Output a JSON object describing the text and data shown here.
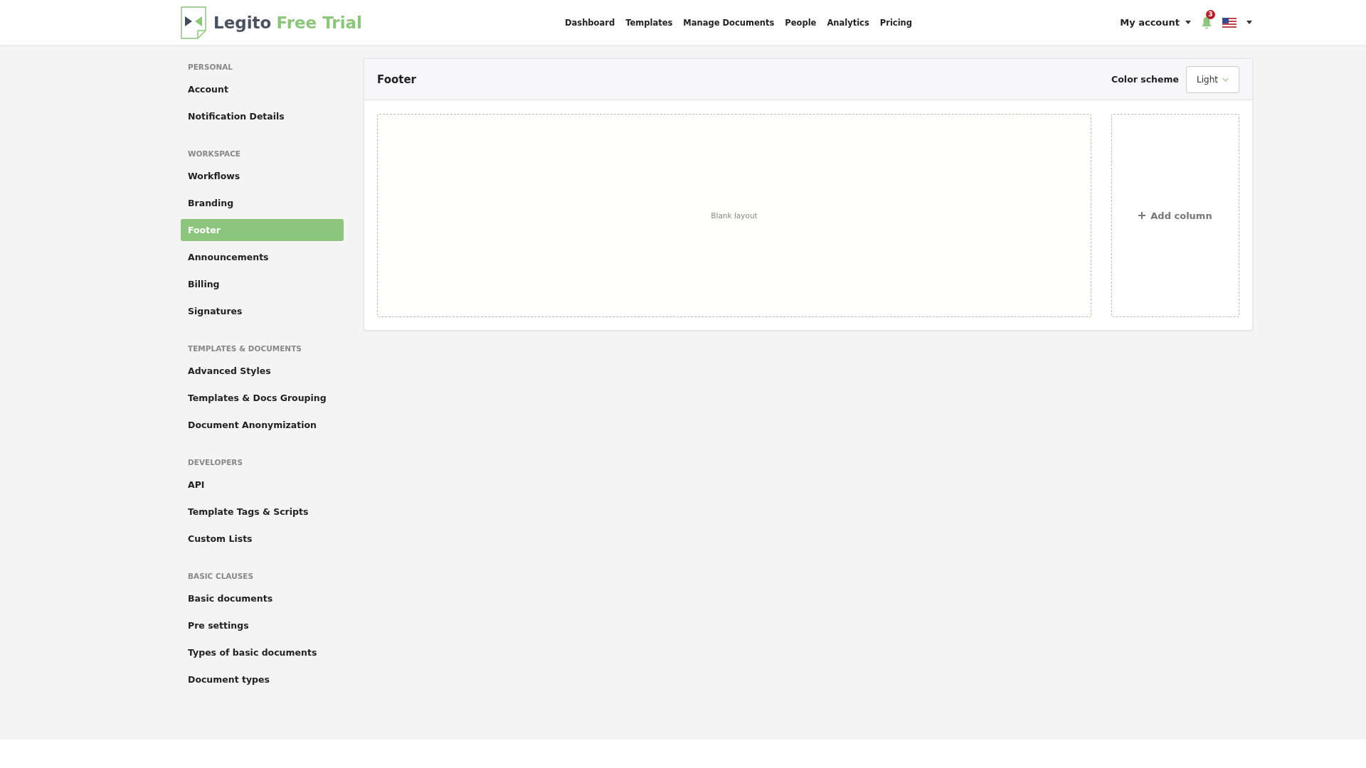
{
  "brand": {
    "name": "Legito",
    "suffix": "Free Trial"
  },
  "nav": [
    {
      "label": "Dashboard"
    },
    {
      "label": "Templates"
    },
    {
      "label": "Manage Documents"
    },
    {
      "label": "People"
    },
    {
      "label": "Analytics"
    },
    {
      "label": "Pricing"
    }
  ],
  "account": {
    "label": "My account",
    "notifications": "3"
  },
  "sidebar": [
    {
      "heading": "PERSONAL",
      "items": [
        {
          "label": "Account",
          "selected": false
        },
        {
          "label": "Notification Details",
          "selected": false
        }
      ]
    },
    {
      "heading": "WORKSPACE",
      "items": [
        {
          "label": "Workflows",
          "selected": false
        },
        {
          "label": "Branding",
          "selected": false
        },
        {
          "label": "Footer",
          "selected": true
        },
        {
          "label": "Announcements",
          "selected": false
        },
        {
          "label": "Billing",
          "selected": false
        },
        {
          "label": "Signatures",
          "selected": false
        }
      ]
    },
    {
      "heading": "TEMPLATES & DOCUMENTS",
      "items": [
        {
          "label": "Advanced Styles",
          "selected": false
        },
        {
          "label": "Templates & Docs Grouping",
          "selected": false
        },
        {
          "label": "Document Anonymization",
          "selected": false
        }
      ]
    },
    {
      "heading": "DEVELOPERS",
      "items": [
        {
          "label": "API",
          "selected": false
        },
        {
          "label": "Template Tags & Scripts",
          "selected": false
        },
        {
          "label": "Custom Lists",
          "selected": false
        }
      ]
    },
    {
      "heading": "BASIC CLAUSES",
      "items": [
        {
          "label": "Basic documents",
          "selected": false
        },
        {
          "label": "Pre settings",
          "selected": false
        },
        {
          "label": "Types of basic documents",
          "selected": false
        },
        {
          "label": "Document types",
          "selected": false
        }
      ]
    }
  ],
  "panel": {
    "title": "Footer",
    "color_scheme_label": "Color scheme",
    "color_scheme": "Light",
    "layout_placeholder": "Blank layout",
    "add_column": "Add column"
  }
}
